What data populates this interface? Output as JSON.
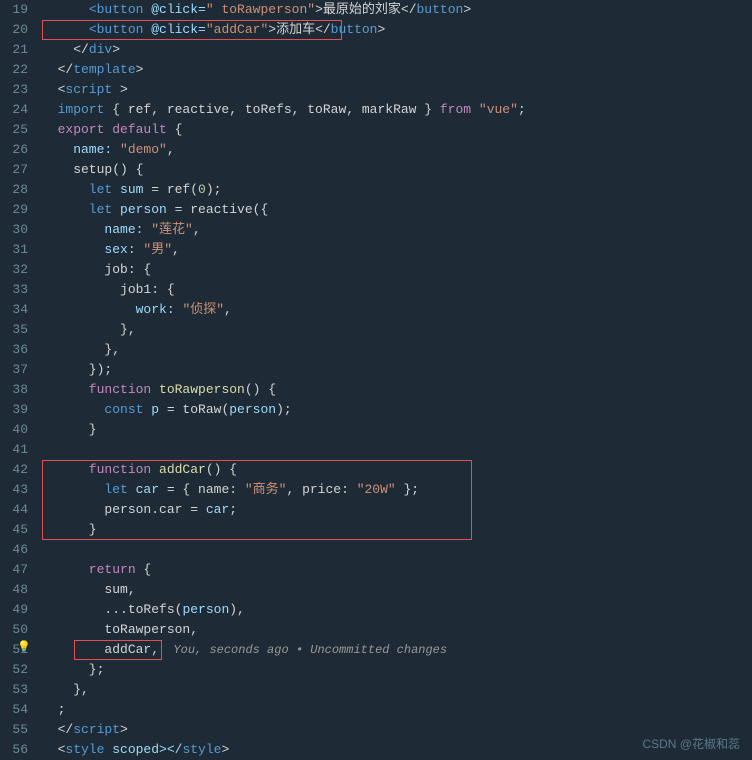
{
  "editor": {
    "title": "Vue Code Editor",
    "watermark": "CSDN @花椒和蕊"
  },
  "lines": [
    {
      "num": 19,
      "tokens": [
        {
          "t": "      ",
          "c": "plain"
        },
        {
          "t": "<button",
          "c": "tag"
        },
        {
          "t": " @click=",
          "c": "attr"
        },
        {
          "t": "\"",
          "c": "attr-value"
        },
        {
          "t": " toRawperson",
          "c": "attr-value"
        },
        {
          "t": "\"",
          "c": "attr-value"
        },
        {
          "t": ">最原始的刘家</",
          "c": "plain"
        },
        {
          "t": "button",
          "c": "tag"
        },
        {
          "t": ">",
          "c": "plain"
        }
      ],
      "box": "none"
    },
    {
      "num": 20,
      "tokens": [
        {
          "t": "      ",
          "c": "plain"
        },
        {
          "t": "<button",
          "c": "tag"
        },
        {
          "t": " @click=",
          "c": "attr"
        },
        {
          "t": "\"addCar\"",
          "c": "attr-value"
        },
        {
          "t": ">添加车</",
          "c": "plain"
        },
        {
          "t": "button",
          "c": "tag"
        },
        {
          "t": ">",
          "c": "plain"
        }
      ],
      "box": "addcar"
    },
    {
      "num": 21,
      "tokens": [
        {
          "t": "    </",
          "c": "plain"
        },
        {
          "t": "div",
          "c": "tag"
        },
        {
          "t": ">",
          "c": "plain"
        }
      ],
      "box": "none"
    },
    {
      "num": 22,
      "tokens": [
        {
          "t": "  </",
          "c": "plain"
        },
        {
          "t": "template",
          "c": "tag"
        },
        {
          "t": ">",
          "c": "plain"
        }
      ],
      "box": "none"
    },
    {
      "num": 23,
      "tokens": [
        {
          "t": "  <",
          "c": "plain"
        },
        {
          "t": "script",
          "c": "tag"
        },
        {
          "t": " >",
          "c": "plain"
        }
      ],
      "box": "none"
    },
    {
      "num": 24,
      "tokens": [
        {
          "t": "  import ",
          "c": "keyword-blue"
        },
        {
          "t": "{ ref, reactive, toRefs, toRaw, markRaw } ",
          "c": "punctuation"
        },
        {
          "t": "from",
          "c": "import-from"
        },
        {
          "t": " ",
          "c": "plain"
        },
        {
          "t": "\"vue\"",
          "c": "string"
        },
        {
          "t": ";",
          "c": "plain"
        }
      ],
      "box": "none"
    },
    {
      "num": 25,
      "tokens": [
        {
          "t": "  export ",
          "c": "keyword"
        },
        {
          "t": "default",
          "c": "keyword"
        },
        {
          "t": " {",
          "c": "plain"
        }
      ],
      "box": "none"
    },
    {
      "num": 26,
      "tokens": [
        {
          "t": "    name: ",
          "c": "property"
        },
        {
          "t": "\"demo\"",
          "c": "string"
        },
        {
          "t": ",",
          "c": "plain"
        }
      ],
      "box": "none"
    },
    {
      "num": 27,
      "tokens": [
        {
          "t": "    setup() {",
          "c": "plain"
        }
      ],
      "box": "none"
    },
    {
      "num": 28,
      "tokens": [
        {
          "t": "      let ",
          "c": "keyword-blue"
        },
        {
          "t": "sum",
          "c": "variable"
        },
        {
          "t": " = ref(",
          "c": "plain"
        },
        {
          "t": "0",
          "c": "number"
        },
        {
          "t": ");",
          "c": "plain"
        }
      ],
      "box": "none"
    },
    {
      "num": 29,
      "tokens": [
        {
          "t": "      let ",
          "c": "keyword-blue"
        },
        {
          "t": "person",
          "c": "variable"
        },
        {
          "t": " = reactive({",
          "c": "plain"
        }
      ],
      "box": "none"
    },
    {
      "num": 30,
      "tokens": [
        {
          "t": "        name: ",
          "c": "property"
        },
        {
          "t": "\"莲花\"",
          "c": "string"
        },
        {
          "t": ",",
          "c": "plain"
        }
      ],
      "box": "none"
    },
    {
      "num": 31,
      "tokens": [
        {
          "t": "        sex: ",
          "c": "property"
        },
        {
          "t": "\"男\"",
          "c": "string"
        },
        {
          "t": ",",
          "c": "plain"
        }
      ],
      "box": "none"
    },
    {
      "num": 32,
      "tokens": [
        {
          "t": "        job: {",
          "c": "plain"
        }
      ],
      "box": "none"
    },
    {
      "num": 33,
      "tokens": [
        {
          "t": "          job1: {",
          "c": "plain"
        }
      ],
      "box": "none"
    },
    {
      "num": 34,
      "tokens": [
        {
          "t": "            work: ",
          "c": "property"
        },
        {
          "t": "\"侦探\"",
          "c": "string"
        },
        {
          "t": ",",
          "c": "plain"
        }
      ],
      "box": "none"
    },
    {
      "num": 35,
      "tokens": [
        {
          "t": "          },",
          "c": "plain"
        }
      ],
      "box": "none"
    },
    {
      "num": 36,
      "tokens": [
        {
          "t": "        },",
          "c": "plain"
        }
      ],
      "box": "none"
    },
    {
      "num": 37,
      "tokens": [
        {
          "t": "      });",
          "c": "plain"
        }
      ],
      "box": "none"
    },
    {
      "num": 38,
      "tokens": [
        {
          "t": "      function ",
          "c": "keyword"
        },
        {
          "t": "toRawperson",
          "c": "func-name"
        },
        {
          "t": "() {",
          "c": "plain"
        }
      ],
      "box": "none"
    },
    {
      "num": 39,
      "tokens": [
        {
          "t": "        const ",
          "c": "keyword-blue"
        },
        {
          "t": "p",
          "c": "variable"
        },
        {
          "t": " = toRaw(",
          "c": "plain"
        },
        {
          "t": "person",
          "c": "variable"
        },
        {
          "t": ");",
          "c": "plain"
        }
      ],
      "box": "none"
    },
    {
      "num": 40,
      "tokens": [
        {
          "t": "      }",
          "c": "plain"
        }
      ],
      "box": "none"
    },
    {
      "num": 41,
      "tokens": [],
      "box": "none"
    },
    {
      "num": 42,
      "tokens": [
        {
          "t": "      function ",
          "c": "keyword"
        },
        {
          "t": "addCar",
          "c": "func-name"
        },
        {
          "t": "() {",
          "c": "plain"
        }
      ],
      "box": "addcar-func-start"
    },
    {
      "num": 43,
      "tokens": [
        {
          "t": "        let ",
          "c": "keyword-blue"
        },
        {
          "t": "car",
          "c": "variable"
        },
        {
          "t": " = { name: ",
          "c": "plain"
        },
        {
          "t": "\"商务\"",
          "c": "string"
        },
        {
          "t": ", price: ",
          "c": "plain"
        },
        {
          "t": "\"20W\"",
          "c": "string"
        },
        {
          "t": " };",
          "c": "plain"
        }
      ],
      "box": "none"
    },
    {
      "num": 44,
      "tokens": [
        {
          "t": "        person.car = ",
          "c": "plain"
        },
        {
          "t": "car",
          "c": "variable"
        },
        {
          "t": ";",
          "c": "plain"
        }
      ],
      "box": "none"
    },
    {
      "num": 45,
      "tokens": [
        {
          "t": "      }",
          "c": "plain"
        }
      ],
      "box": "addcar-func-end"
    },
    {
      "num": 46,
      "tokens": [],
      "box": "none"
    },
    {
      "num": 47,
      "tokens": [
        {
          "t": "      return ",
          "c": "keyword"
        },
        {
          "t": "{",
          "c": "plain"
        }
      ],
      "box": "none"
    },
    {
      "num": 48,
      "tokens": [
        {
          "t": "        sum,",
          "c": "plain"
        }
      ],
      "box": "none"
    },
    {
      "num": 49,
      "tokens": [
        {
          "t": "        ...toRefs(",
          "c": "plain"
        },
        {
          "t": "person",
          "c": "variable"
        },
        {
          "t": "),",
          "c": "plain"
        }
      ],
      "box": "none"
    },
    {
      "num": 50,
      "tokens": [
        {
          "t": "        toRawperson,",
          "c": "plain"
        }
      ],
      "box": "none"
    },
    {
      "num": 51,
      "tokens": [
        {
          "t": "        addCar,",
          "c": "plain"
        },
        {
          "t": "  You, seconds ago • Uncommitted changes",
          "c": "status"
        }
      ],
      "box": "addcar-return",
      "hasIcon": true
    },
    {
      "num": 52,
      "tokens": [
        {
          "t": "      };",
          "c": "plain"
        }
      ],
      "box": "none"
    },
    {
      "num": 53,
      "tokens": [
        {
          "t": "    },",
          "c": "plain"
        }
      ],
      "box": "none"
    },
    {
      "num": 54,
      "tokens": [
        {
          "t": "  ;",
          "c": "plain"
        }
      ],
      "box": "none"
    },
    {
      "num": 55,
      "tokens": [
        {
          "t": "  </",
          "c": "plain"
        },
        {
          "t": "script",
          "c": "tag"
        },
        {
          "t": ">",
          "c": "plain"
        }
      ],
      "box": "none"
    },
    {
      "num": 56,
      "tokens": [
        {
          "t": "  <",
          "c": "plain"
        },
        {
          "t": "style",
          "c": "tag"
        },
        {
          "t": " scoped></",
          "c": "attr"
        },
        {
          "t": "style",
          "c": "tag"
        },
        {
          "t": ">",
          "c": "plain"
        }
      ],
      "box": "none"
    }
  ]
}
